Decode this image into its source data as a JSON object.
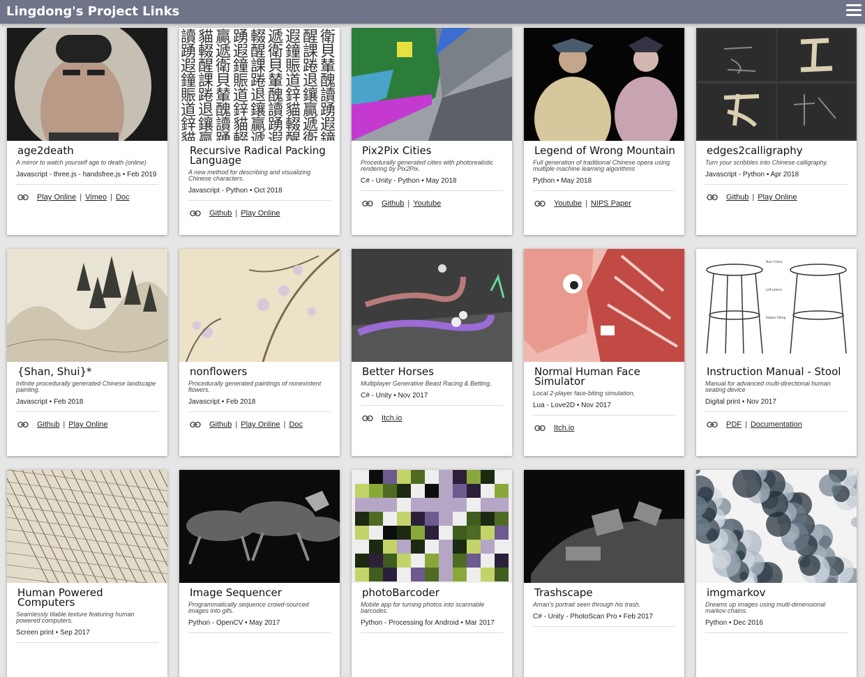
{
  "header": {
    "title": "Lingdong's Project Links",
    "menu_icon": "hamburger-menu-icon"
  },
  "colors": {
    "topbar": "#6f7488",
    "page_bg": "#e6e6e6",
    "card_bg": "#ffffff"
  },
  "projects": [
    {
      "name": "age2death",
      "desc": "A mirror to watch yourself age to death (online)",
      "meta": "Javascript - three.js - handsfree.js • Feb 2019",
      "links": [
        "Play Online",
        "Vimeo",
        "Doc"
      ],
      "thumb": "portrait"
    },
    {
      "name": "Recursive Radical Packing Language",
      "desc": "A new method for describing and visualizing Chinese characters.",
      "meta": "Javascript - Python • Oct 2018",
      "links": [
        "Github",
        "Play Online"
      ],
      "thumb": "glyphs"
    },
    {
      "name": "Pix2Pix Cities",
      "desc": "Procedurally generated cities with photorealistic rendering by Pix2Pix.",
      "meta": "C# - Unity - Python • May 2018",
      "links": [
        "Github",
        "Youtube"
      ],
      "thumb": "city"
    },
    {
      "name": "Legend of Wrong Mountain",
      "desc": "Full generation of traditional Chinese opera using multiple machine learning algorithms",
      "meta": "Python • May 2018",
      "links": [
        "Youtube",
        "NIPS Paper"
      ],
      "thumb": "opera"
    },
    {
      "name": "edges2calligraphy",
      "desc": "Turn your scribbles into Chinese calligraphy.",
      "meta": "Javascript - Python • Apr 2018",
      "links": [
        "Github",
        "Play Online"
      ],
      "thumb": "calligraphy"
    },
    {
      "name": "{Shan, Shui}*",
      "desc": "Infinite procedurally generated Chinese landscape painting.",
      "meta": "Javascript • Feb 2018",
      "links": [
        "Github",
        "Play Online"
      ],
      "thumb": "landscape"
    },
    {
      "name": "nonflowers",
      "desc": "Procedurally generated paintings of nonexistent flowers.",
      "meta": "Javascript • Feb 2018",
      "links": [
        "Github",
        "Play Online",
        "Doc"
      ],
      "thumb": "flowers"
    },
    {
      "name": "Better Horses",
      "desc": "Multiplayer Generative Beast Racing & Betting.",
      "meta": "C# - Unity • Nov 2017",
      "links": [
        "Itch.io"
      ],
      "thumb": "horses3d"
    },
    {
      "name": "Normal Human Face Simulator",
      "desc": "Local 2-player face-biting simulation.",
      "meta": "Lua - Love2D • Nov 2017",
      "links": [
        "Itch.io"
      ],
      "thumb": "faces"
    },
    {
      "name": "Instruction Manual - Stool",
      "desc": "Manual for advanced multi-directional human seating device",
      "meta": "Digital print • Nov 2017",
      "links": [
        "PDF",
        "Documentation"
      ],
      "thumb": "stool"
    },
    {
      "name": "Human Powered Computers",
      "desc": "Seamlessly tilable texture featuring human powered computers.",
      "meta": "Screen print • Sep 2017",
      "links": [],
      "thumb": "etching"
    },
    {
      "name": "Image Sequencer",
      "desc": "Programmatically sequence crowd-sourced images into gifs.",
      "meta": "Python - OpenCV • May 2017",
      "links": [],
      "thumb": "running"
    },
    {
      "name": "photoBarcoder",
      "desc": "Mobile app for turning photos into scannable barcodes.",
      "meta": "Python - Processing for Android • Mar 2017",
      "links": [],
      "thumb": "pixel"
    },
    {
      "name": "Trashscape",
      "desc": "Aman's portrait seen through his trash.",
      "meta": "C# - Unity - PhotoScan Pro • Feb 2017",
      "links": [],
      "thumb": "trash"
    },
    {
      "name": "imgmarkov",
      "desc": "Dreams up images using multi-dimensional markov chains.",
      "meta": "Python • Dec 2016",
      "links": [],
      "thumb": "markov"
    }
  ]
}
